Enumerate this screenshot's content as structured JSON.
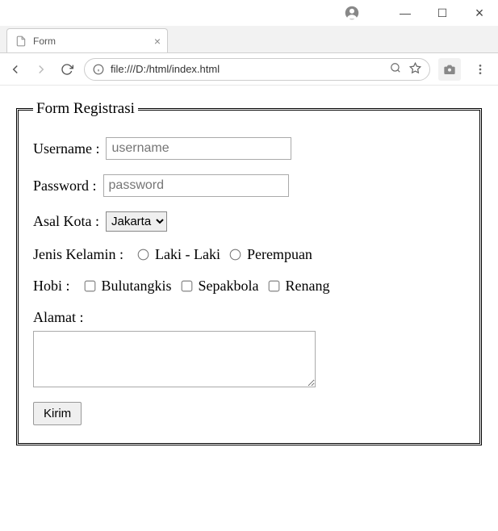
{
  "window": {
    "tab_title": "Form",
    "close": "×",
    "maximize": "☐",
    "minimize": "—"
  },
  "address_bar": {
    "url": "file:///D:/html/index.html"
  },
  "form": {
    "legend": "Form Registrasi",
    "username_label": "Username :",
    "username_placeholder": "username",
    "password_label": "Password :",
    "password_placeholder": "password",
    "city_label": "Asal Kota :",
    "city_selected": "Jakarta",
    "gender_label": "Jenis Kelamin :",
    "gender_opt1": "Laki - Laki",
    "gender_opt2": "Perempuan",
    "hobby_label": "Hobi :",
    "hobby_opt1": "Bulutangkis",
    "hobby_opt2": "Sepakbola",
    "hobby_opt3": "Renang",
    "address_label": "Alamat :",
    "submit_label": "Kirim"
  }
}
